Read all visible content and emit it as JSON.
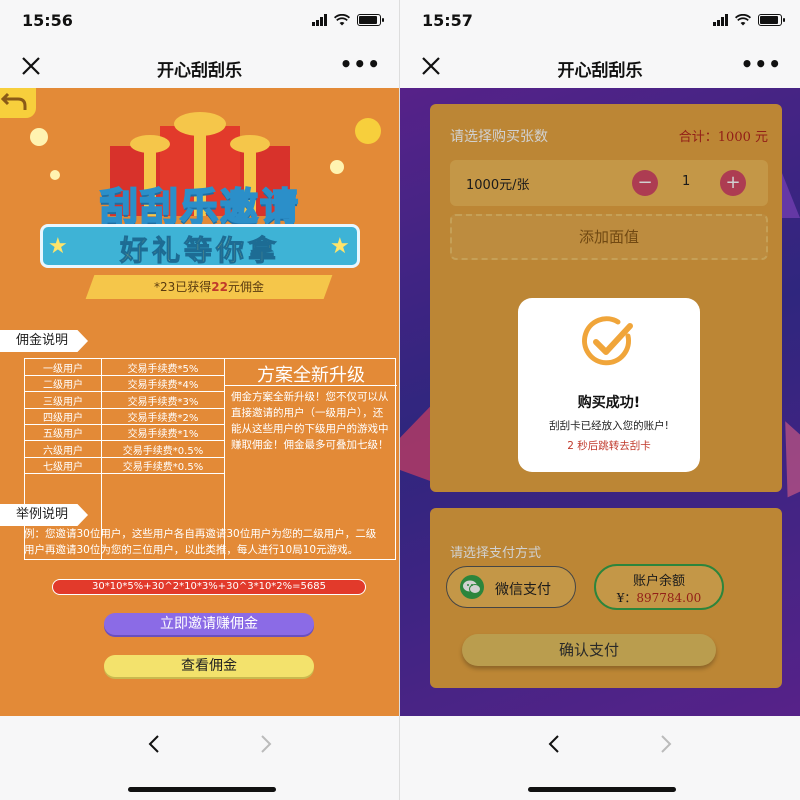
{
  "colors": {
    "left_bg": "#e38a37",
    "right_bg": "#4a2fa0",
    "panel": "#e6a441",
    "accent_red": "#b3261e",
    "wechat_green": "#36a34a",
    "invite_purple": "#8b6be6"
  },
  "left": {
    "status": {
      "time": "15:56",
      "battery_level": 0.9
    },
    "nav": {
      "title": "开心刮刮乐",
      "close_icon": "close-icon",
      "more_icon": "more-icon"
    },
    "hero": {
      "title": "刮刮乐邀请",
      "subtitle": "好礼等你拿",
      "gain_prefix": "*23已获得",
      "gain_amount": "22",
      "gain_suffix": "元佣金"
    },
    "commission": {
      "section_label": "佣金说明",
      "rows": [
        {
          "level": "一级用户",
          "fee": "交易手续费*5%"
        },
        {
          "level": "二级用户",
          "fee": "交易手续费*4%"
        },
        {
          "level": "三级用户",
          "fee": "交易手续费*3%"
        },
        {
          "level": "四级用户",
          "fee": "交易手续费*2%"
        },
        {
          "level": "五级用户",
          "fee": "交易手续费*1%"
        },
        {
          "level": "六级用户",
          "fee": "交易手续费*0.5%"
        },
        {
          "level": "七级用户",
          "fee": "交易手续费*0.5%"
        }
      ],
      "upgrade_title": "方案全新升级",
      "upgrade_desc": "佣金方案全新升级！您不仅可以从直接邀请的用户（一级用户），还能从这些用户的下级用户的游戏中赚取佣金！佣金最多可叠加七级！"
    },
    "example": {
      "section_label": "举例说明",
      "text": "例：您邀请30位用户，这些用户各自再邀请30位用户为您的二级用户，二级用户再邀请30位为您的三位用户，以此类推，每人进行10局10元游戏。",
      "formula": "30*10*5%+30^2*10*3%+30^3*10*2%=5685"
    },
    "buttons": {
      "invite": "立即邀请赚佣金",
      "view": "查看佣金"
    }
  },
  "right": {
    "status": {
      "time": "15:57",
      "battery_level": 0.9
    },
    "nav": {
      "title": "开心刮刮乐"
    },
    "purchase": {
      "label": "请选择购买张数",
      "total": "合计：1000 元",
      "price": "1000元/张",
      "quantity": "1",
      "minus": "−",
      "plus": "+",
      "add_face": "添加面值"
    },
    "modal": {
      "title": "购买成功!",
      "message": "刮刮卡已经放入您的账户!",
      "redirect": "2 秒后跳转去刮卡"
    },
    "payment": {
      "label": "请选择支付方式",
      "wechat": "微信支付",
      "balance_label": "账户余额",
      "balance_currency": "¥：",
      "balance_amount": "897784.00",
      "confirm": "确认支付"
    }
  }
}
